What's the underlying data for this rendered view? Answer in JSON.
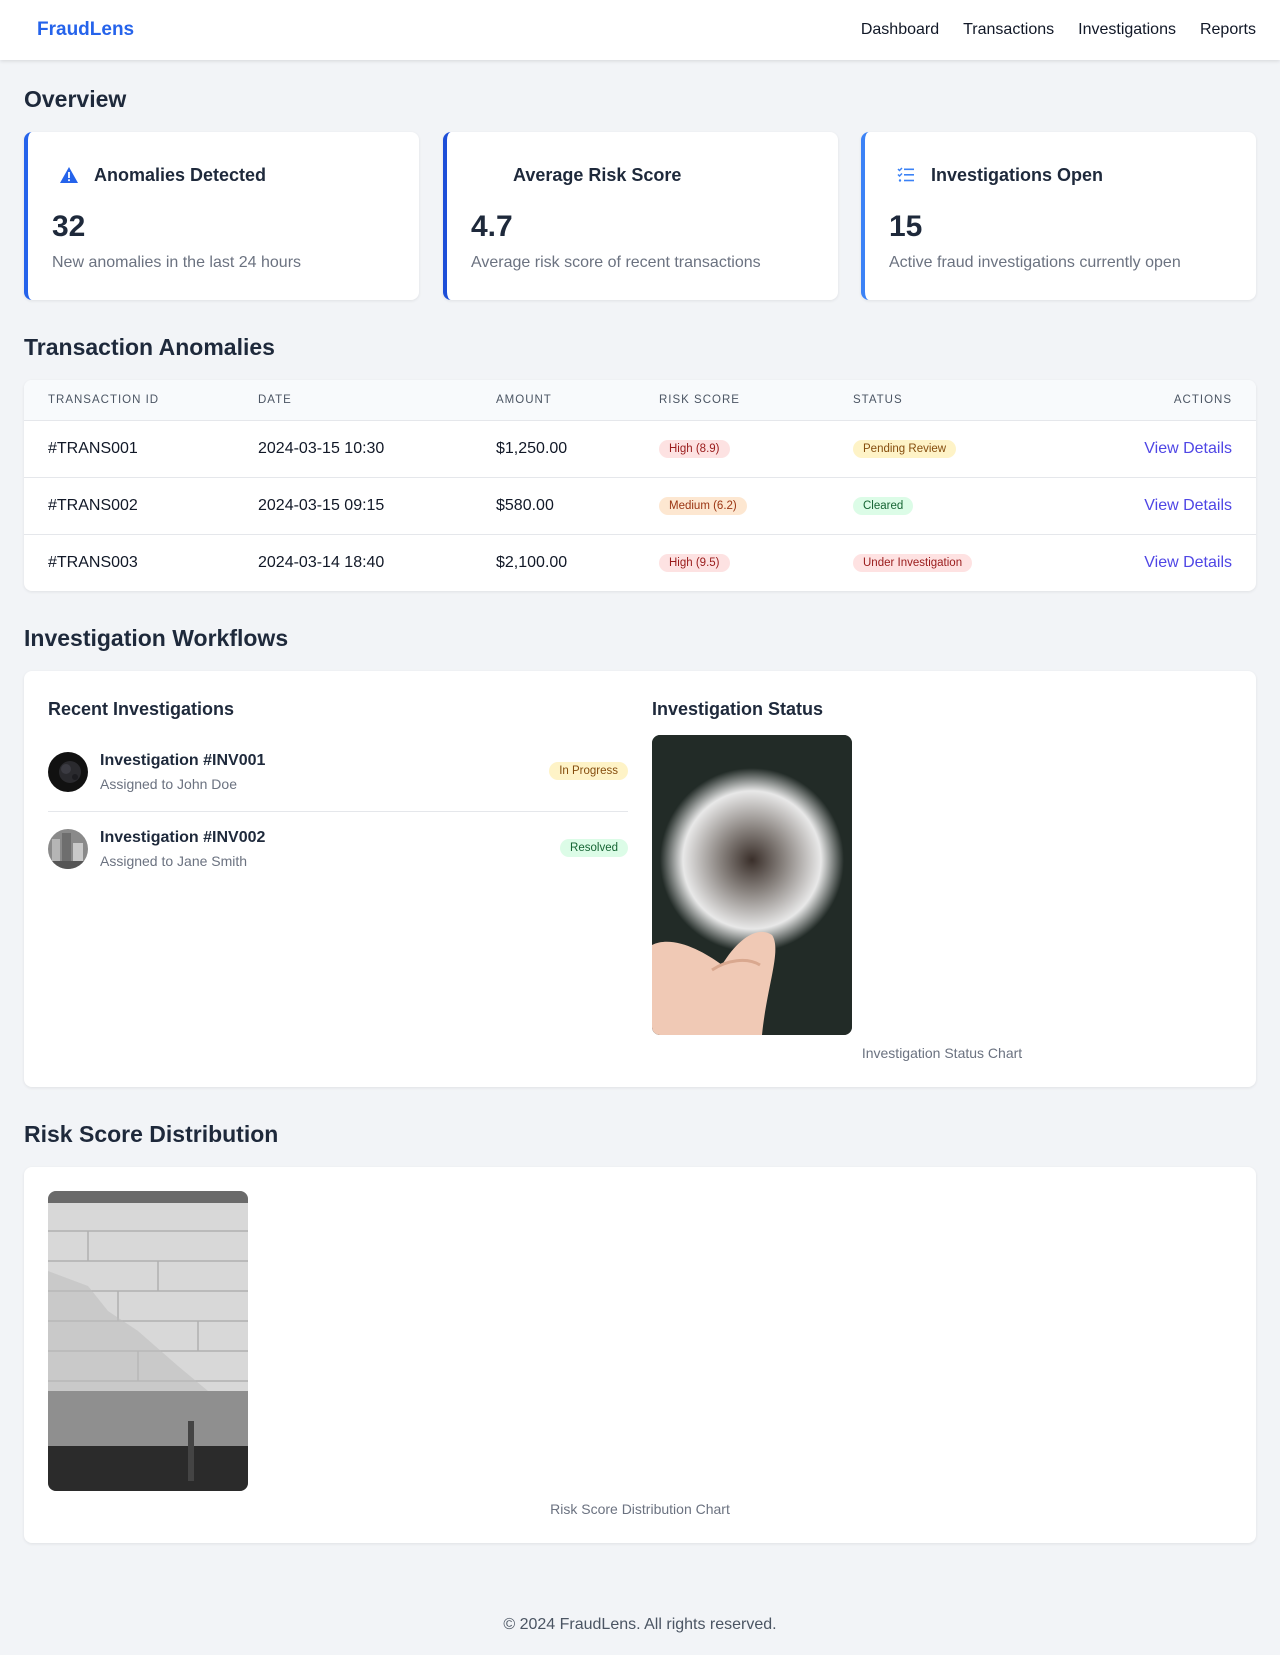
{
  "app": {
    "brand": "FraudLens",
    "nav": [
      "Dashboard",
      "Transactions",
      "Investigations",
      "Reports"
    ]
  },
  "overview": {
    "title": "Overview",
    "cards": [
      {
        "title": "Anomalies Detected",
        "value": "32",
        "description": "New anomalies in the last 24 hours",
        "icon": "warning-triangle-icon",
        "accent": "#2563eb"
      },
      {
        "title": "Average Risk Score",
        "value": "4.7",
        "description": "Average risk score of recent transactions",
        "icon": "none",
        "accent": "#1d4ed8"
      },
      {
        "title": "Investigations Open",
        "value": "15",
        "description": "Active fraud investigations currently open",
        "icon": "checklist-icon",
        "accent": "#3b82f6"
      }
    ]
  },
  "anomalies": {
    "title": "Transaction Anomalies",
    "columns": [
      "TRANSACTION ID",
      "DATE",
      "AMOUNT",
      "RISK SCORE",
      "STATUS",
      "ACTIONS"
    ],
    "rows": [
      {
        "id": "#TRANS001",
        "date": "2024-03-15 10:30",
        "amount": "$1,250.00",
        "risk": "High (8.9)",
        "status": "Pending Review",
        "action": "View Details"
      },
      {
        "id": "#TRANS002",
        "date": "2024-03-15 09:15",
        "amount": "$580.00",
        "risk": "Medium (6.2)",
        "status": "Cleared",
        "action": "View Details"
      },
      {
        "id": "#TRANS003",
        "date": "2024-03-14 18:40",
        "amount": "$2,100.00",
        "risk": "High (9.5)",
        "status": "Under Investigation",
        "action": "View Details"
      }
    ]
  },
  "workflows": {
    "title": "Investigation Workflows",
    "recent_title": "Recent Investigations",
    "status_title": "Investigation Status",
    "items": [
      {
        "name": "Investigation #INV001",
        "assignee": "Assigned to John Doe",
        "status": "In Progress"
      },
      {
        "name": "Investigation #INV002",
        "assignee": "Assigned to Jane Smith",
        "status": "Resolved"
      }
    ],
    "chart_caption": "Investigation Status Chart"
  },
  "risk": {
    "title": "Risk Score Distribution",
    "chart_caption": "Risk Score Distribution Chart"
  },
  "footer": "© 2024 FraudLens. All rights reserved."
}
